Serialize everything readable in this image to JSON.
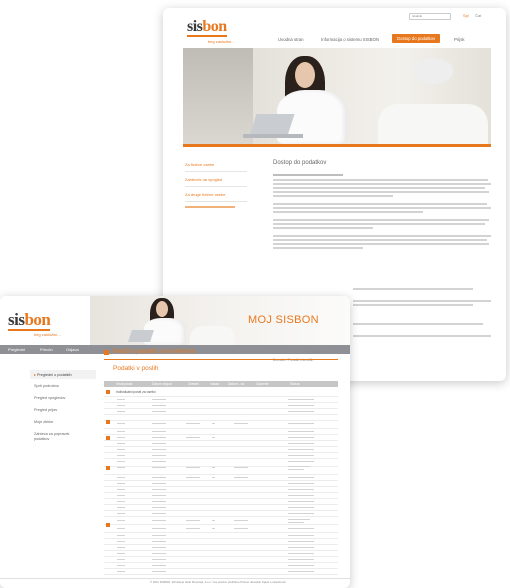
{
  "colors": {
    "accent": "#e8781e",
    "text": "#555555",
    "subnav": "#8e9095"
  },
  "back_page": {
    "logo_main": "sis",
    "logo_accent": "bon",
    "logo_tagline": "beg zaslužim...",
    "topbar": {
      "search_placeholder": "Iskalnik",
      "links": [
        "Spl",
        "Čat"
      ]
    },
    "nav": [
      "Uvodna stran",
      "Informacija o sistemu SISBON",
      "Dostop do podatkov",
      "Prijsk"
    ],
    "sidebar": [
      "Za fizične osebe",
      "Zahtevek na vpogled",
      "Za druge fizične osebe"
    ],
    "content_title": "Dostop do podatkov"
  },
  "front_page": {
    "logo_main": "sis",
    "logo_accent": "bon",
    "logo_tagline": "beg zaslužim...",
    "header_title": "MOJ SISBON",
    "subnav": [
      "Pregledni",
      "Priročn",
      "Odjava"
    ],
    "breadcrumb": "Domačo / Podatki o kreditih",
    "left_nav": [
      "Pregledni o podatkih",
      "Sprti podrobno",
      "Pregled vpogledov",
      "Pregled prijav",
      "Moje zbirke",
      "Zahteva za popravek podatkov"
    ],
    "main_title": "Matični podatki za komitenta",
    "print_label": "Natisni",
    "section_title": "Podatki v poslih",
    "table_headers": [
      "Vrsta posla",
      "Datum dogod",
      "Znesek",
      "Valuta",
      "Datum - do",
      "Opombe",
      "Status"
    ],
    "group_label": "Individualni posel za osebo",
    "footer": "© 2011 SISBON, Združenje bank Slovenije, d.o.o.   Vse pravice pridržane   Pravno obvestilo   Izjava o zasebnosti"
  }
}
